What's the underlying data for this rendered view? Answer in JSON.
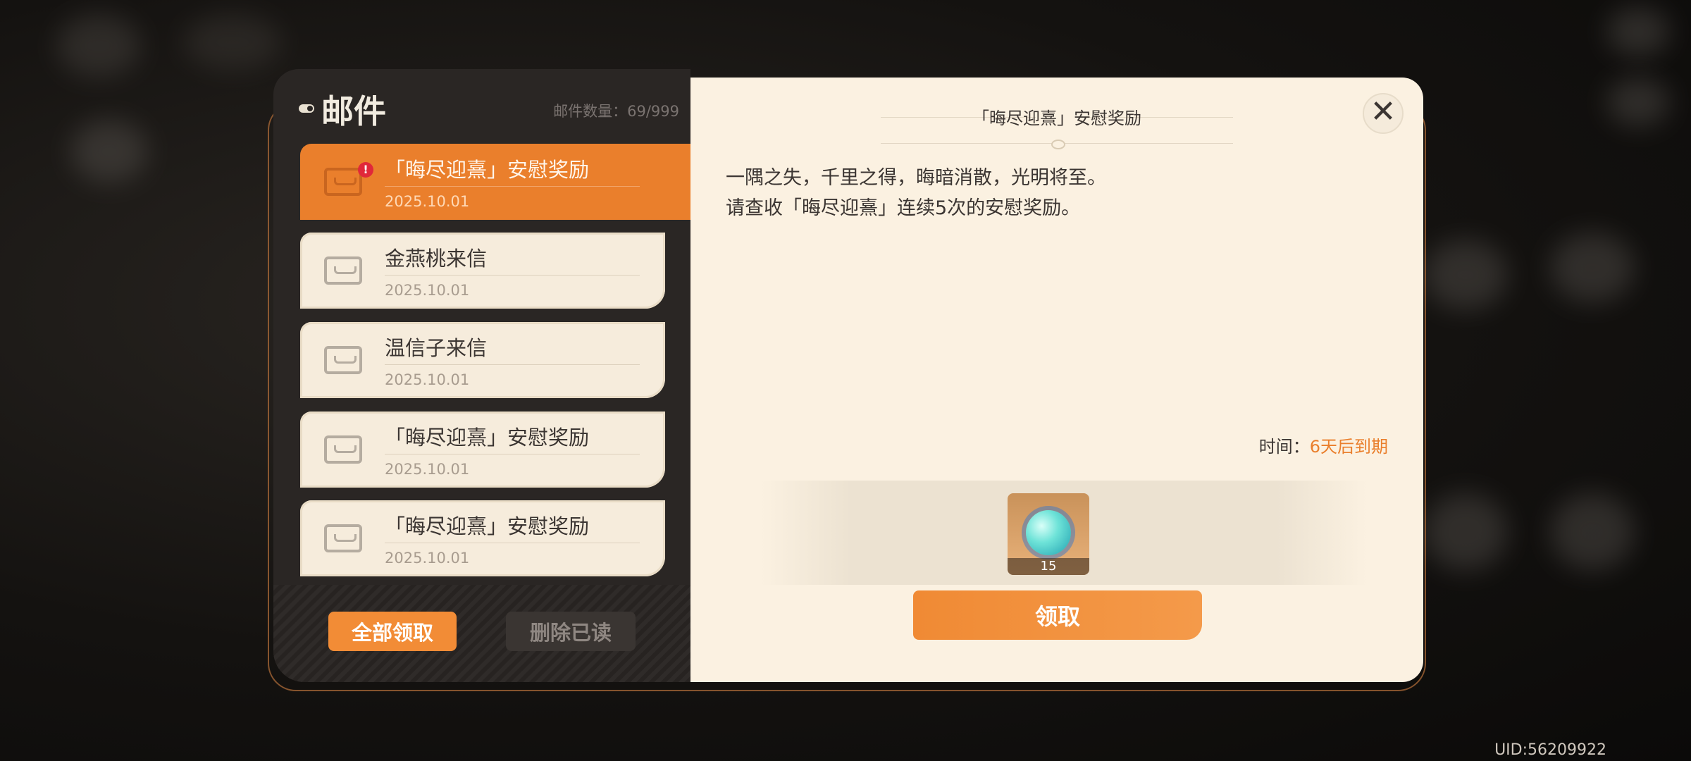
{
  "left": {
    "title": "邮件",
    "count_label": "邮件数量：69/999",
    "items": [
      {
        "name": "「晦尽迎熹」安慰奖励",
        "date": "2025.10.01",
        "active": true,
        "unread_badge": "!"
      },
      {
        "name": "金燕桃来信",
        "date": "2025.10.01"
      },
      {
        "name": "温信子来信",
        "date": "2025.10.01"
      },
      {
        "name": "「晦尽迎熹」安慰奖励",
        "date": "2025.10.01"
      },
      {
        "name": "「晦尽迎熹」安慰奖励",
        "date": "2025.10.01"
      }
    ],
    "claim_all_label": "全部领取",
    "delete_read_label": "删除已读"
  },
  "detail": {
    "title": "「晦尽迎熹」安慰奖励",
    "body_line1": "一隅之失，千里之得，晦暗消散，光明将至。",
    "body_line2": "请查收「晦尽迎熹」连续5次的安慰奖励。",
    "expire_label": "时间：",
    "expire_value": "6天后到期",
    "reward_qty": "15",
    "claim_label": "领取",
    "close_icon": "close-icon"
  },
  "uid": "UID:56209922",
  "colors": {
    "accent": "#ea7f2c",
    "panel_dark": "#2a2624",
    "panel_light": "#fbf1e1"
  }
}
